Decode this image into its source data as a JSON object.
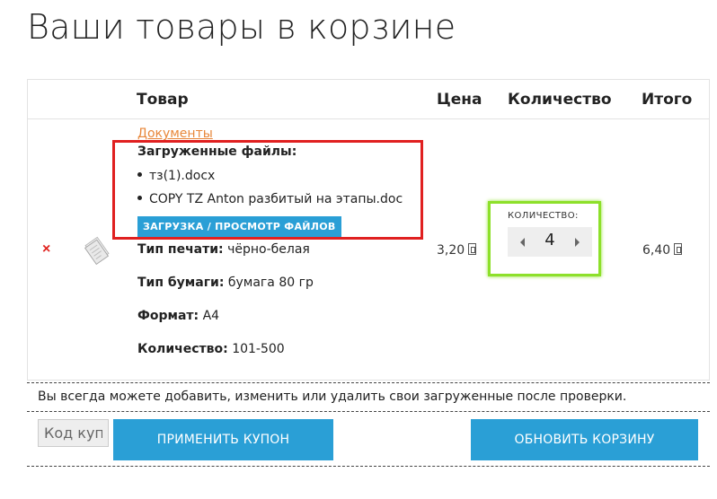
{
  "page": {
    "title": "Ваши товары в корзине"
  },
  "table": {
    "headers": {
      "product": "Товар",
      "price": "Цена",
      "quantity": "Количество",
      "total": "Итого"
    }
  },
  "item": {
    "remove_symbol": "×",
    "documents_link": "Документы",
    "uploaded_files_label": "Загруженные файлы:",
    "files": [
      "тз(1).docx",
      "COPY TZ Anton разбитый на этапы.doc"
    ],
    "upload_button": "ЗАГРУЗКА / ПРОСМОТР ФАЙЛОВ",
    "attributes": [
      {
        "label": "Тип печати:",
        "value": "чёрно-белая"
      },
      {
        "label": "Тип бумаги:",
        "value": "бумага 80 гр"
      },
      {
        "label": "Формат:",
        "value": "A4"
      },
      {
        "label": "Количество:",
        "value": "101-500"
      }
    ],
    "price": "3,20",
    "quantity_label": "КОЛИЧЕСТВО:",
    "quantity": "4",
    "total": "6,40"
  },
  "notice": "Вы всегда можете добавить, изменить или удалить свои загруженные после проверки.",
  "coupon": {
    "placeholder": "Код купона"
  },
  "buttons": {
    "apply_coupon": "ПРИМЕНИТЬ КУПОН",
    "update_cart": "ОБНОВИТЬ КОРЗИНУ"
  },
  "colors": {
    "accent": "#2a9fd6",
    "link": "#e8873a",
    "remove": "#e0231f",
    "highlight_red": "#e02020",
    "highlight_green": "#8de02a"
  }
}
